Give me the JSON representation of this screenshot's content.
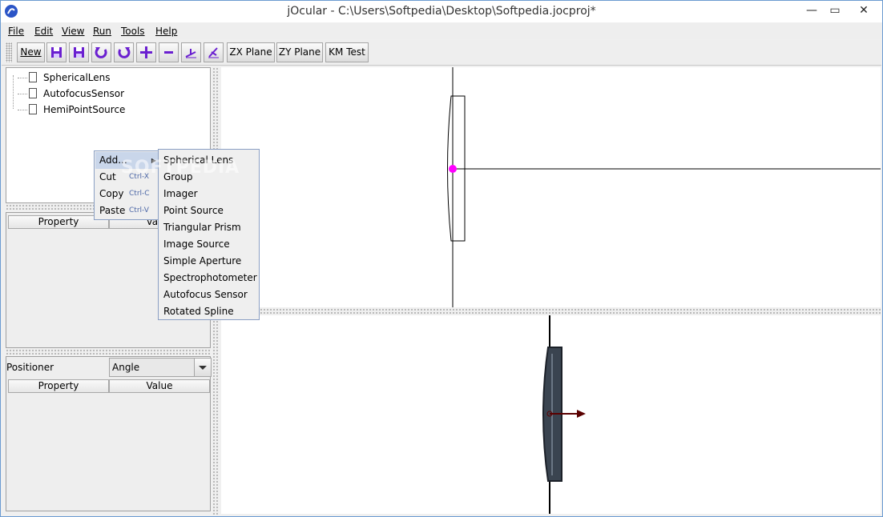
{
  "window": {
    "title": "jOcular - C:\\Users\\Softpedia\\Desktop\\Softpedia.jocproj*",
    "controls": {
      "minimize": "—",
      "maximize": "▭",
      "close": "✕"
    }
  },
  "menubar": [
    "File",
    "Edit",
    "View",
    "Run",
    "Tools",
    "Help"
  ],
  "toolbar": {
    "new_label": "New",
    "zx_label": "ZX Plane",
    "zy_label": "ZY Plane",
    "km_label": "KM Test",
    "icons": [
      "save-icon",
      "save-as-icon",
      "undo-icon",
      "redo-icon",
      "add-icon",
      "remove-icon",
      "pen-icon",
      "pen-alt-icon"
    ],
    "icon_color": "#6a1fd0"
  },
  "tree": {
    "items": [
      "SphericalLens",
      "AutofocusSensor",
      "HemiPointSource"
    ]
  },
  "properties_table": {
    "columns": [
      "Property",
      "Value"
    ]
  },
  "positioner": {
    "label": "Positioner",
    "selected": "Angle"
  },
  "positioner_table": {
    "columns": [
      "Property",
      "Value"
    ]
  },
  "context_menu": {
    "items": [
      {
        "label": "Add...",
        "shortcut": "",
        "has_submenu": true
      },
      {
        "label": "Cut",
        "shortcut": "Ctrl-X"
      },
      {
        "label": "Copy",
        "shortcut": "Ctrl-C"
      },
      {
        "label": "Paste",
        "shortcut": "Ctrl-V"
      }
    ]
  },
  "submenu": {
    "items": [
      "Spherical Lens",
      "Group",
      "Imager",
      "Point Source",
      "Triangular Prism",
      "Image Source",
      "Simple Aperture",
      "Spectrophotometer",
      "Autofocus Sensor",
      "Rotated Spline"
    ]
  },
  "watermark": "SOFTPEDIA",
  "colors": {
    "highlight": "#c9d6ea",
    "point": "#ff00ff",
    "lens_3d": "#3a4450",
    "arrow": "#5a0000"
  }
}
